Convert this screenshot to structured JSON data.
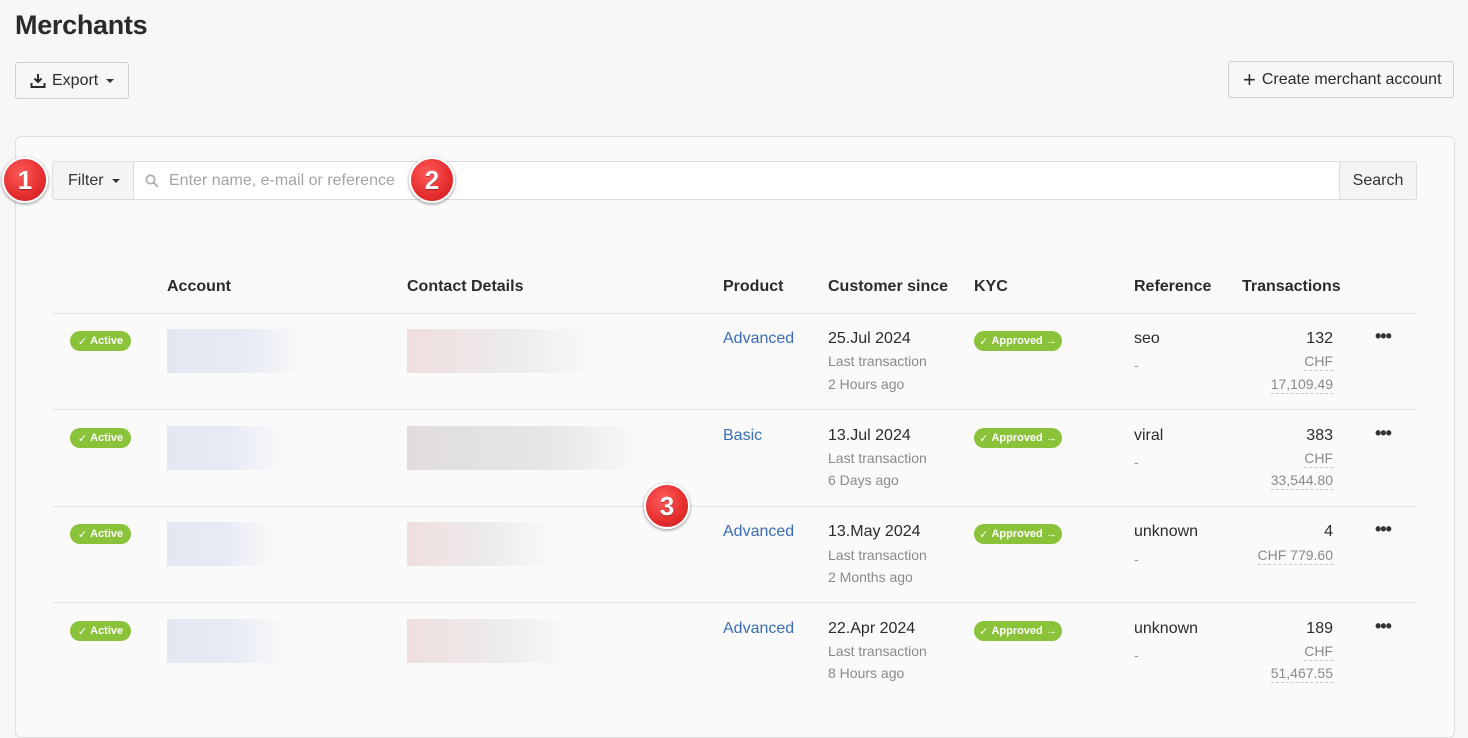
{
  "page": {
    "title": "Merchants"
  },
  "toolbar": {
    "export_label": "Export",
    "create_label": "Create merchant account"
  },
  "search": {
    "filter_label": "Filter",
    "placeholder": "Enter name, e-mail or reference",
    "value": "",
    "button_label": "Search"
  },
  "table": {
    "headers": {
      "account": "Account",
      "contact": "Contact Details",
      "product": "Product",
      "customer_since": "Customer since",
      "kyc": "KYC",
      "reference": "Reference",
      "transactions": "Transactions"
    },
    "rows": [
      {
        "status": "Active",
        "product": "Advanced",
        "since": "25.Jul 2024",
        "last_label": "Last transaction",
        "last_ago": "2 Hours ago",
        "kyc": "Approved",
        "reference": "seo",
        "reference_sub": "-",
        "tx_count": "132",
        "currency": "CHF",
        "amount": "17,109.49"
      },
      {
        "status": "Active",
        "product": "Basic",
        "since": "13.Jul 2024",
        "last_label": "Last transaction",
        "last_ago": "6 Days ago",
        "kyc": "Approved",
        "reference": "viral",
        "reference_sub": "-",
        "tx_count": "383",
        "currency": "CHF",
        "amount": "33,544.80"
      },
      {
        "status": "Active",
        "product": "Advanced",
        "since": "13.May 2024",
        "last_label": "Last transaction",
        "last_ago": "2 Months ago",
        "kyc": "Approved",
        "reference": "unknown",
        "reference_sub": "-",
        "tx_count": "4",
        "amount_inline": "CHF 779.60"
      },
      {
        "status": "Active",
        "product": "Advanced",
        "since": "22.Apr 2024",
        "last_label": "Last transaction",
        "last_ago": "8 Hours ago",
        "kyc": "Approved",
        "reference": "unknown",
        "reference_sub": "-",
        "tx_count": "189",
        "currency": "CHF",
        "amount": "51,467.55"
      }
    ]
  },
  "annotations": {
    "m1": "1",
    "m2": "2",
    "m3": "3"
  },
  "colors": {
    "accent_green": "#8ac33a",
    "link_blue": "#3a6db5",
    "marker_red": "#e52d2d"
  },
  "icons": {
    "export": "download-icon",
    "create": "plus-icon",
    "search": "magnifier-icon",
    "menu": "ellipsis-icon",
    "check": "check-icon",
    "arrow": "arrow-right-icon"
  }
}
